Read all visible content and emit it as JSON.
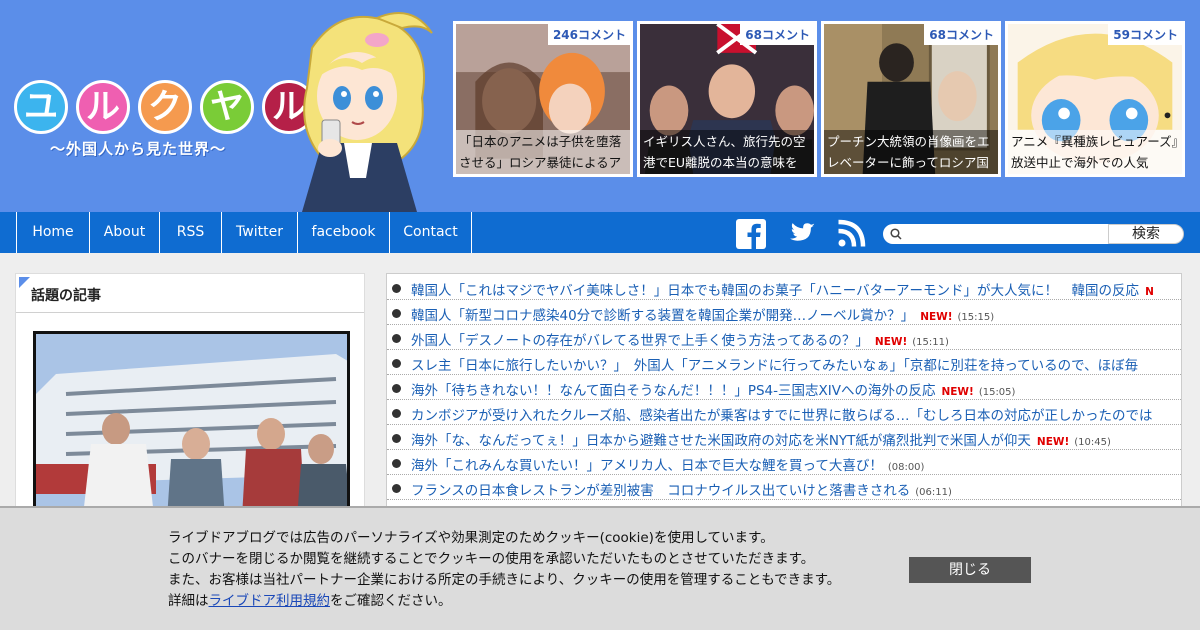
{
  "site": {
    "logo_chars": [
      "ユ",
      "ル",
      "ク",
      "ヤ",
      "ル"
    ],
    "logo_colors": [
      "#3cb4ee",
      "#ef5fb1",
      "#f59a4f",
      "#7acc37",
      "#b52048"
    ],
    "subtitle": "〜外国人から見た世界〜"
  },
  "thumbs": [
    {
      "count": "246コメント",
      "title": "「日本のアニメは子供を堕落させる」ロシア暴徒によるア"
    },
    {
      "count": "68コメント",
      "title": "イギリス人さん、旅行先の空港でEU離脱の本当の意味を"
    },
    {
      "count": "68コメント",
      "title": "プーチン大統領の肖像画をエレベーターに飾ってロシア国"
    },
    {
      "count": "59コメント",
      "title": "アニメ『異種族レビュアーズ』放送中止で海外での人気"
    }
  ],
  "nav": [
    "Home",
    "About",
    "RSS",
    "Twitter",
    "facebook",
    "Contact"
  ],
  "search": {
    "placeholder": "",
    "button": "検索"
  },
  "sidebar": {
    "title": "話題の記事"
  },
  "articles": [
    {
      "text": "韓国人「これはマジでヤバイ美味しさ！」日本でも韓国のお菓子「ハニーバターアーモンド」が大人気に！　韓国の反応",
      "new": "N",
      "time": ""
    },
    {
      "text": "韓国人「新型コロナ感染40分で診断する装置を韓国企業が開発…ノーベル賞か？」",
      "new": "NEW!",
      "time": "(15:15)"
    },
    {
      "text": "外国人「デスノートの存在がバレてる世界で上手く使う方法ってあるの？」",
      "new": "NEW!",
      "time": "(15:11)"
    },
    {
      "text": "スレ主「日本に旅行したいかい？」　外国人「アニメランドに行ってみたいなぁ」「京都に別荘を持っているので、ほぼ毎",
      "new": "",
      "time": ""
    },
    {
      "text": "海外「待ちきれない！！なんて面白そうなんだ！！！」PS4-三国志XIVへの海外の反応",
      "new": "NEW!",
      "time": "(15:05)"
    },
    {
      "text": "カンボジアが受け入れたクルーズ船、感染者出たが乗客はすでに世界に散らばる…「むしろ日本の対応が正しかったのでは",
      "new": "",
      "time": ""
    },
    {
      "text": "海外「な、なんだってぇ！」日本から避難させた米国政府の対応を米NYT紙が痛烈批判で米国人が仰天",
      "new": "NEW!",
      "time": "(10:45)"
    },
    {
      "text": "海外「これみんな買いたい！」アメリカ人、日本で巨大な鯉を買って大喜び！",
      "new": "",
      "time": "(08:00)"
    },
    {
      "text": "フランスの日本食レストランが差別被害　コロナウイルス出ていけと落書きされる",
      "new": "",
      "time": "(06:11)"
    }
  ],
  "cookie": {
    "line1": "ライブドアブログでは広告のパーソナライズや効果測定のためクッキー(cookie)を使用しています。",
    "line2": "このバナーを閉じるか閲覧を継続することでクッキーの使用を承認いただいたものとさせていただきます。",
    "line3": "また、お客様は当社パートナー企業における所定の手続きにより、クッキーの使用を管理することもできます。",
    "line4_prefix": "詳細は",
    "link": "ライブドア利用規約",
    "line4_suffix": "をご確認ください。",
    "close": "閉じる"
  },
  "colors": {
    "header_bg": "#5b8ee9",
    "nav_bg": "#0f6cd1",
    "link": "#1a5fb4",
    "new": "#e00000"
  }
}
